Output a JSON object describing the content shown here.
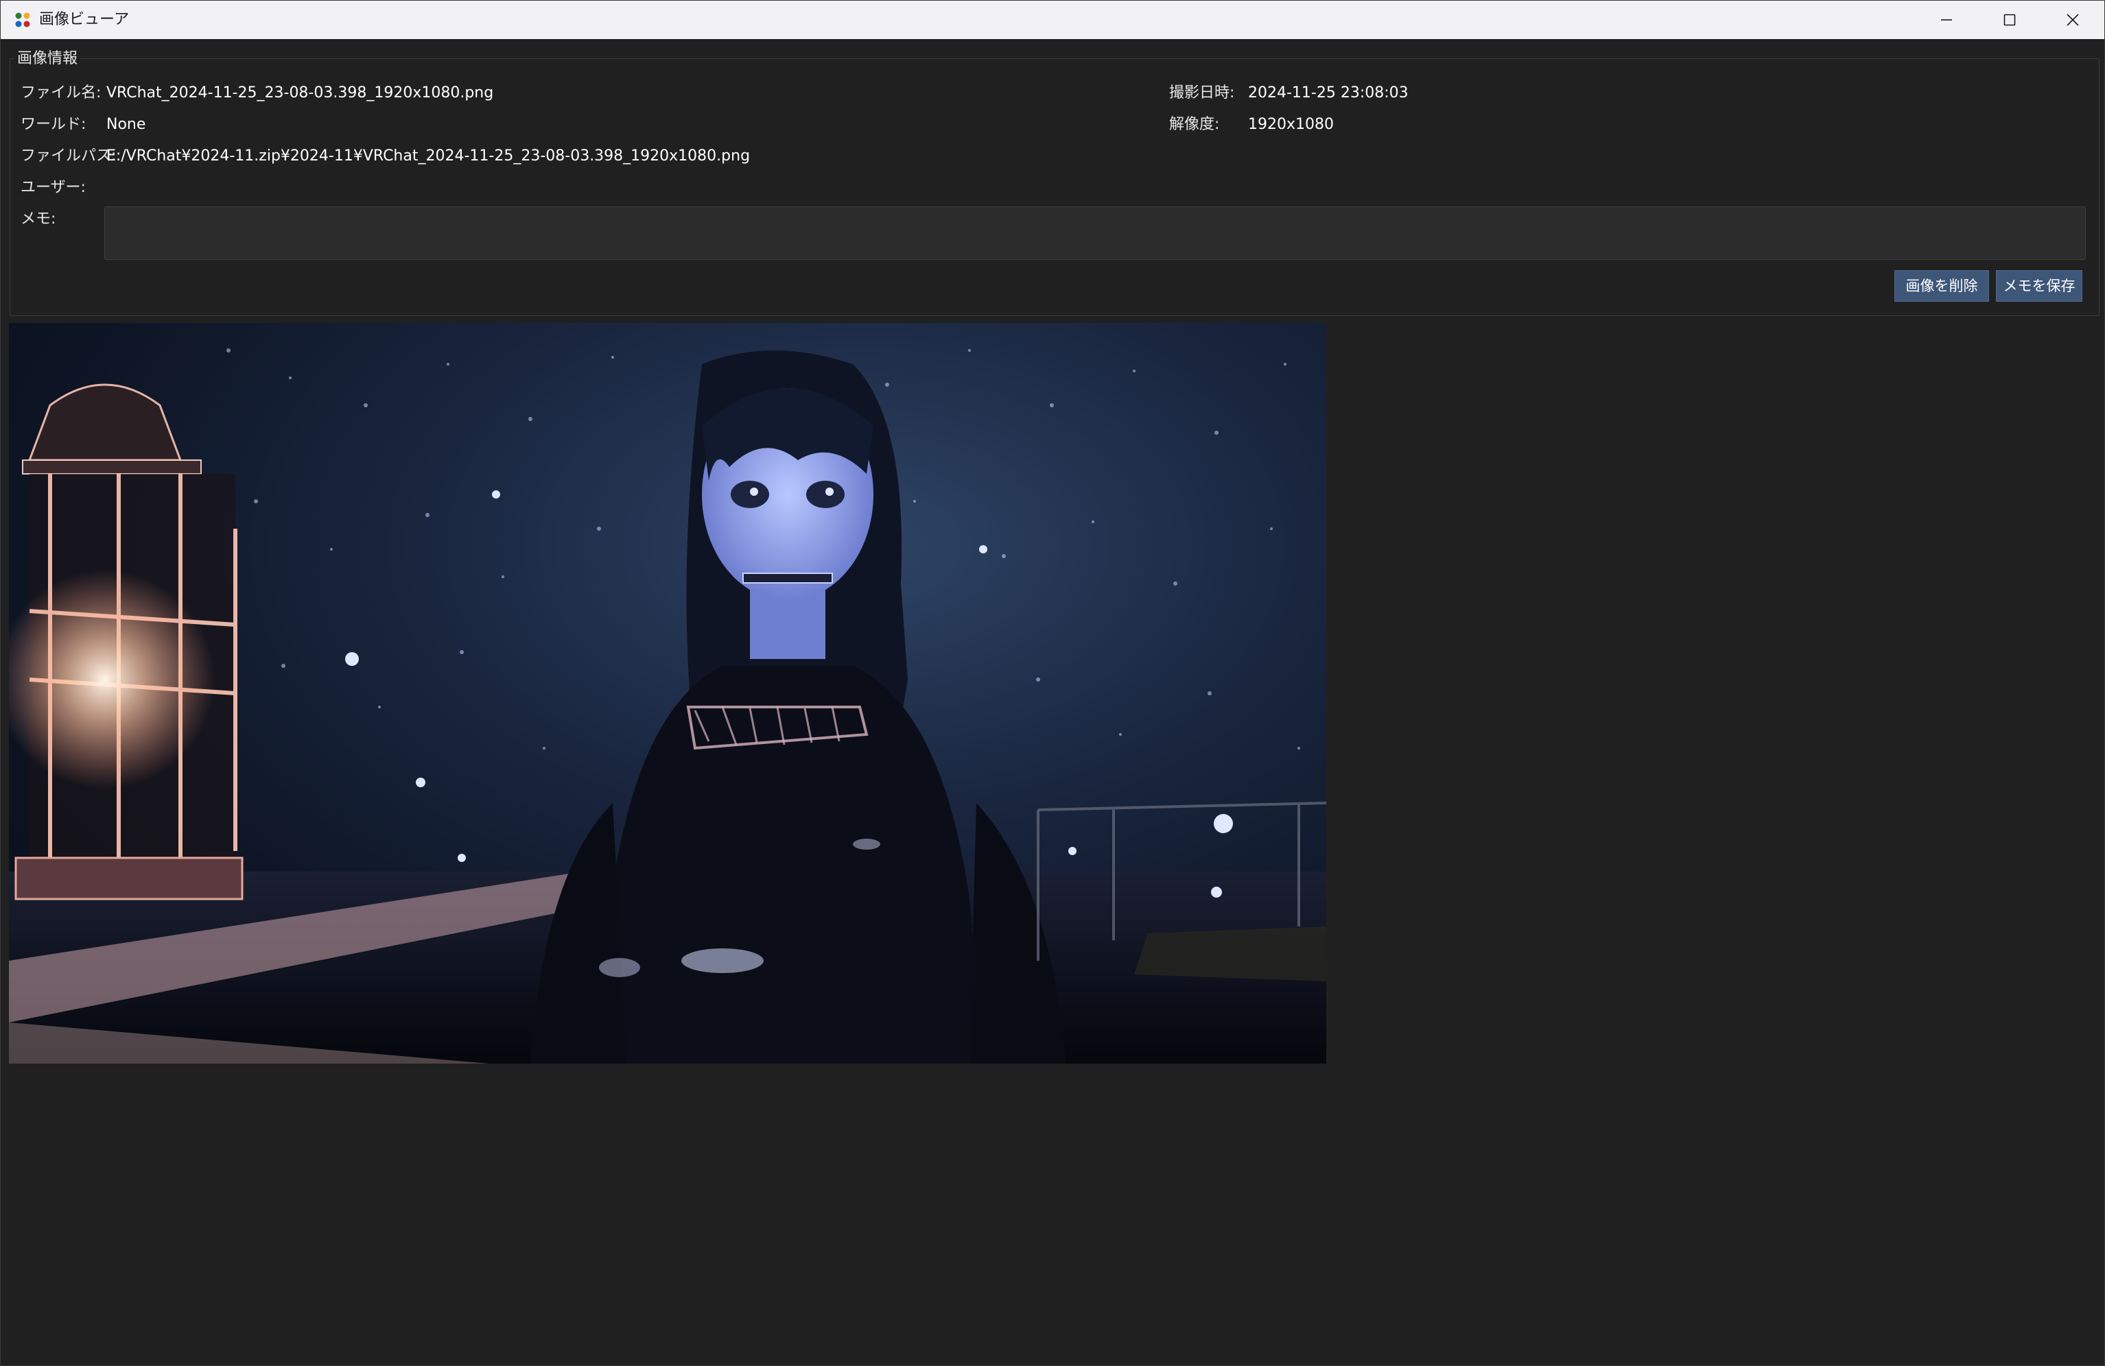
{
  "window": {
    "title": "画像ビューア",
    "controls": {
      "minimize": "minimize-icon",
      "maximize": "maximize-icon",
      "close": "close-icon"
    }
  },
  "info": {
    "group_title": "画像情報",
    "filename_label": "ファイル名:",
    "filename": "VRChat_2024-11-25_23-08-03.398_1920x1080.png",
    "world_label": "ワールド:",
    "world": "None",
    "path_label": "ファイルパス:",
    "path": "E:/VRChat¥2024-11.zip¥2024-11¥VRChat_2024-11-25_23-08-03.398_1920x1080.png",
    "user_label": "ユーザー:",
    "user": "",
    "memo_label": "メモ:",
    "memo": "",
    "datetime_label": "撮影日時:",
    "datetime": "2024-11-25 23:08:03",
    "resolution_label": "解像度:",
    "resolution": "1920x1080"
  },
  "buttons": {
    "delete_label": "画像を削除",
    "save_label": "メモを保存"
  },
  "colors": {
    "background": "#202020",
    "titlebar": "#f2f1f4",
    "button": "#3e5678"
  }
}
